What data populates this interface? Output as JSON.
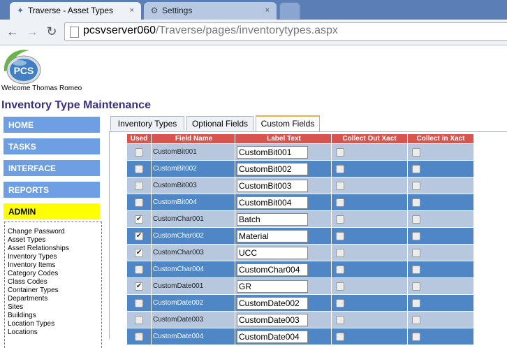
{
  "browser": {
    "tabs": [
      {
        "title": "Traverse - Asset Types",
        "icon": "traverse-favicon",
        "close": "×"
      },
      {
        "title": "Settings",
        "icon": "gear-icon",
        "close": "×"
      }
    ],
    "nav": {
      "back": "←",
      "forward": "→",
      "reload": "↻"
    },
    "url_host": "pcsvserver060",
    "url_path": "/Traverse/pages/inventorytypes.aspx"
  },
  "header": {
    "logo_text": "PCS",
    "welcome": "Welcome Thomas Romeo",
    "page_title": "Inventory Type Maintenance"
  },
  "sidebar": {
    "items": [
      "HOME",
      "TASKS",
      "INTERFACE",
      "REPORTS",
      "ADMIN"
    ],
    "admin_submenu": [
      "Change Password",
      "Asset Types",
      "Asset Relationships",
      "Inventory Types",
      "Inventory Items",
      "Category Codes",
      "Class Codes",
      "Container Types",
      "Departments",
      "Sites",
      "Buildings",
      "Location Types",
      "Locations"
    ]
  },
  "content_tabs": [
    "Inventory Types",
    "Optional Fields",
    "Custom Fields"
  ],
  "active_tab": "Custom Fields",
  "grid": {
    "headers": [
      "Used",
      "Field Name",
      "Label Text",
      "Collect Out Xact",
      "Collect in Xact"
    ],
    "rows": [
      {
        "used": false,
        "field": "CustomBit001",
        "label": "CustomBit001"
      },
      {
        "used": false,
        "field": "CustomBit002",
        "label": "CustomBit002"
      },
      {
        "used": false,
        "field": "CustomBit003",
        "label": "CustomBit003"
      },
      {
        "used": false,
        "field": "CustomBit004",
        "label": "CustomBit004"
      },
      {
        "used": true,
        "field": "CustomChar001",
        "label": "Batch"
      },
      {
        "used": true,
        "field": "CustomChar002",
        "label": "Material"
      },
      {
        "used": true,
        "field": "CustomChar003",
        "label": "UCC"
      },
      {
        "used": false,
        "field": "CustomChar004",
        "label": "CustomChar004"
      },
      {
        "used": true,
        "field": "CustomDate001",
        "label": "GR"
      },
      {
        "used": false,
        "field": "CustomDate002",
        "label": "CustomDate002"
      },
      {
        "used": false,
        "field": "CustomDate003",
        "label": "CustomDate003"
      },
      {
        "used": false,
        "field": "CustomDate004",
        "label": "CustomDate004"
      }
    ]
  },
  "colors": {
    "header_red": "#d9534f",
    "row_light": "#b7c7dd",
    "row_dark": "#4f86c6",
    "nav_blue": "#6f9fe3",
    "nav_admin": "#ffff00",
    "title_purple": "#3c2e7c"
  }
}
